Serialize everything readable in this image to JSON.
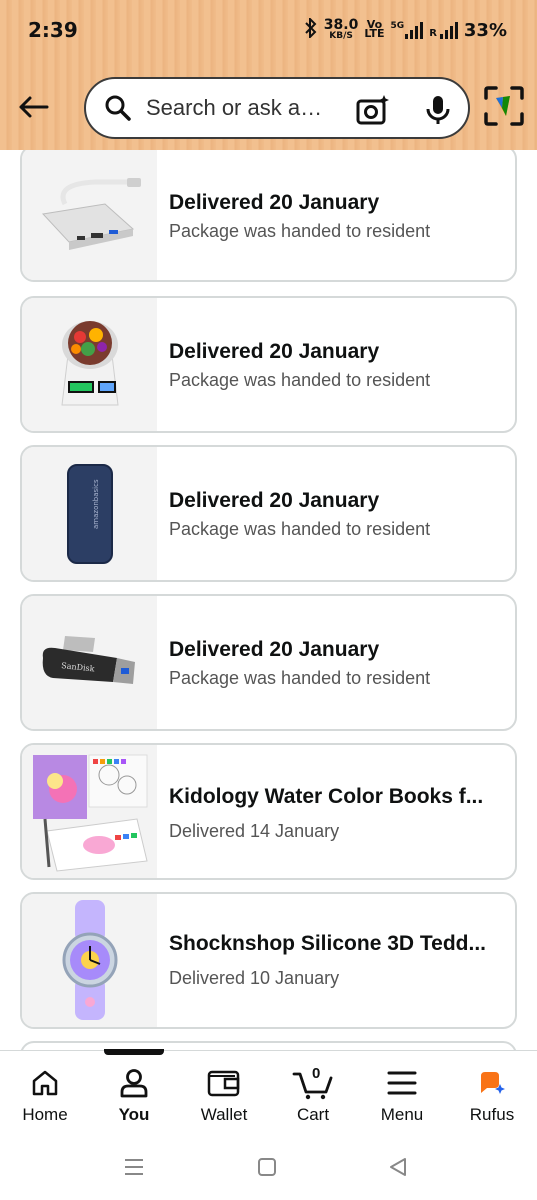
{
  "status_bar": {
    "time": "2:39",
    "speed_value": "38.0",
    "speed_unit": "KB/S",
    "volte_top": "Vo",
    "volte_bottom": "LTE",
    "network": "5G",
    "roaming": "R",
    "battery": "33%"
  },
  "search": {
    "placeholder": "Search or ask a…"
  },
  "orders": [
    {
      "title": "Delivered 20 January",
      "subtitle": "Package was handed to resident",
      "image": "usb-c-hub"
    },
    {
      "title": "Delivered 20 January",
      "subtitle": "Package was handed to resident",
      "image": "kitchen-scale"
    },
    {
      "title": "Delivered 20 January",
      "subtitle": "Package was handed to resident",
      "image": "power-bank"
    },
    {
      "title": "Delivered 20 January",
      "subtitle": "Package was handed to resident",
      "image": "sandisk-usb-drive"
    },
    {
      "title": "Kidology Water Color Books f...",
      "subtitle": "Delivered 14 January",
      "image": "watercolor-book"
    },
    {
      "title": "Shocknshop Silicone 3D Tedd...",
      "subtitle": "Delivered 10 January",
      "image": "kids-watch"
    }
  ],
  "bottom_nav": {
    "home": "Home",
    "you": "You",
    "wallet": "Wallet",
    "cart": "Cart",
    "cart_count": "0",
    "menu": "Menu",
    "rufus": "Rufus"
  },
  "colors": {
    "header_bg": "#f2c08f",
    "card_border": "#d5d9d9",
    "rufus_orange": "#f97316",
    "rufus_blue": "#2563eb"
  }
}
